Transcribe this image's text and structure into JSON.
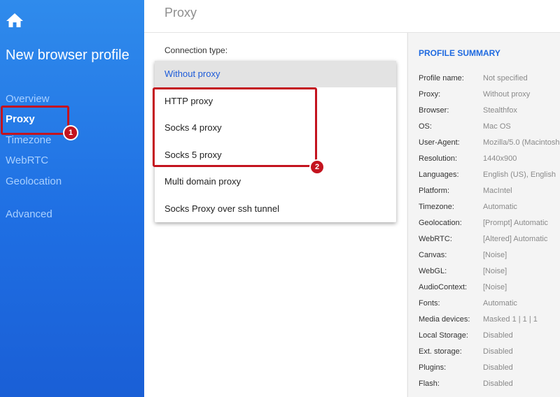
{
  "sidebar": {
    "title": "New browser profile",
    "nav": [
      {
        "label": "Overview"
      },
      {
        "label": "Proxy"
      },
      {
        "label": "Timezone"
      },
      {
        "label": "WebRTC"
      },
      {
        "label": "Geolocation"
      },
      {
        "label": "Advanced"
      }
    ],
    "active": "Proxy"
  },
  "annotations": [
    "1",
    "2"
  ],
  "header": {
    "title": "Proxy"
  },
  "form": {
    "connection_label": "Connection type:",
    "options": [
      {
        "label": "Without proxy",
        "selected": true
      },
      {
        "label": "HTTP proxy"
      },
      {
        "label": "Socks 4 proxy"
      },
      {
        "label": "Socks 5 proxy"
      },
      {
        "label": "Multi domain proxy"
      },
      {
        "label": "Socks Proxy over ssh tunnel"
      }
    ]
  },
  "summary": {
    "title": "PROFILE SUMMARY",
    "rows": [
      {
        "key": "Profile name:",
        "value": "Not specified"
      },
      {
        "key": "Proxy:",
        "value": "Without proxy"
      },
      {
        "key": "Browser:",
        "value": "Stealthfox"
      },
      {
        "key": "OS:",
        "value": "Mac OS"
      },
      {
        "key": "User-Agent:",
        "value": "Mozilla/5.0 (Macintosh"
      },
      {
        "key": "Resolution:",
        "value": "1440x900"
      },
      {
        "key": "Languages:",
        "value": "English (US), English"
      },
      {
        "key": "Platform:",
        "value": "MacIntel"
      },
      {
        "key": "Timezone:",
        "value": "Automatic"
      },
      {
        "key": "Geolocation:",
        "value": "[Prompt] Automatic"
      },
      {
        "key": "WebRTC:",
        "value": "[Altered] Automatic"
      },
      {
        "key": "Canvas:",
        "value": "[Noise]"
      },
      {
        "key": "WebGL:",
        "value": "[Noise]"
      },
      {
        "key": "AudioContext:",
        "value": "[Noise]"
      },
      {
        "key": "Fonts:",
        "value": "Automatic"
      },
      {
        "key": "Media devices:",
        "value": "Masked 1 | 1 | 1"
      },
      {
        "key": "Local Storage:",
        "value": "Disabled"
      },
      {
        "key": "Ext. storage:",
        "value": "Disabled"
      },
      {
        "key": "Plugins:",
        "value": "Disabled"
      },
      {
        "key": "Flash:",
        "value": "Disabled"
      }
    ]
  },
  "colors": {
    "sidebar_top": "#2f8bec",
    "sidebar_bottom": "#1a5fd6",
    "accent": "#1f6ae0",
    "highlight": "#c4141f"
  }
}
